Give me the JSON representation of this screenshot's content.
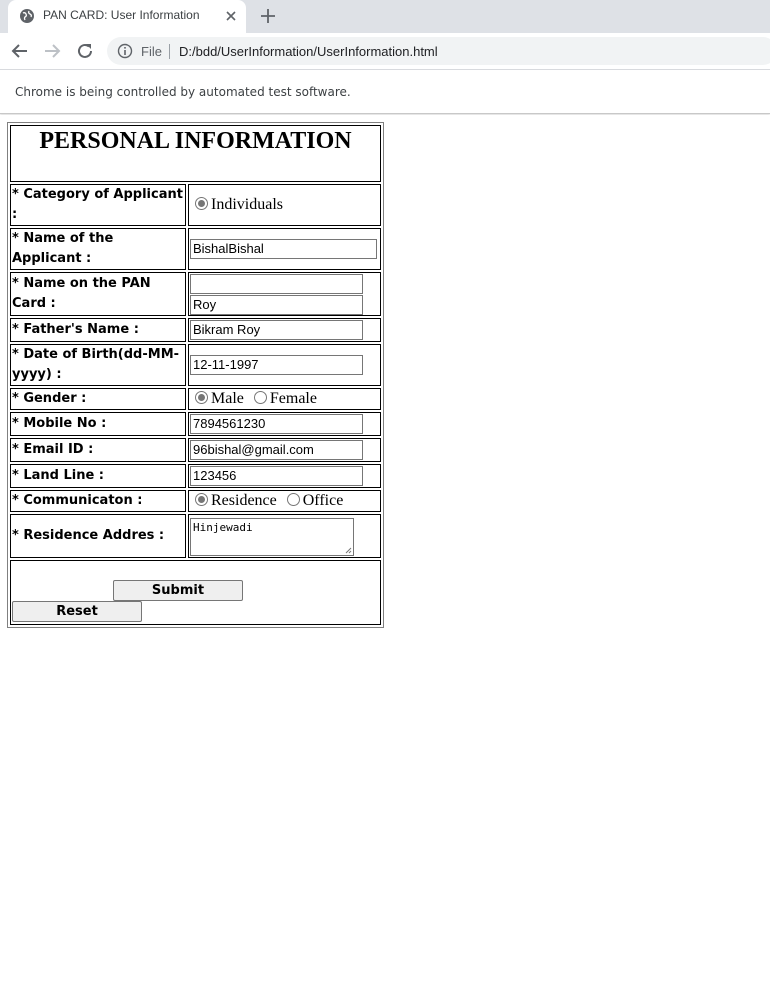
{
  "browser": {
    "tab_title": "PAN CARD: User Information",
    "omnibox_scheme": "File",
    "url": "D:/bdd/UserInformation/UserInformation.html",
    "infobar_text": "Chrome is being controlled by automated test software."
  },
  "form": {
    "title": "PERSONAL INFORMATION",
    "category": {
      "label": "* Category of Applicant :",
      "option": "Individuals",
      "selected": true
    },
    "applicant_name": {
      "label": "* Name of the Applicant :",
      "value": "BishalBishal"
    },
    "pan_name": {
      "label": "* Name on the PAN Card :",
      "value1": "",
      "value2": "Roy"
    },
    "father_name": {
      "label": "* Father's Name :",
      "value": "Bikram Roy"
    },
    "dob": {
      "label": "* Date of Birth(dd-MM-yyyy) :",
      "value": "12-11-1997"
    },
    "gender": {
      "label": "* Gender :",
      "options": [
        "Male",
        "Female"
      ],
      "selected": "Male"
    },
    "mobile": {
      "label": "* Mobile No :",
      "value": "7894561230"
    },
    "email": {
      "label": "* Email ID :",
      "value": "96bishal@gmail.com"
    },
    "landline": {
      "label": "* Land Line :",
      "value": "123456"
    },
    "communication": {
      "label": "* Communicaton :",
      "options": [
        "Residence",
        "Office"
      ],
      "selected": "Residence"
    },
    "address": {
      "label": "* Residence Addres :",
      "value": "Hinjewadi"
    },
    "submit_label": "Submit",
    "reset_label": "Reset"
  },
  "icons": [
    "globe-icon",
    "close-icon",
    "plus-icon",
    "back-arrow-icon",
    "forward-arrow-icon",
    "reload-icon",
    "info-icon",
    "resize-grip-icon"
  ]
}
